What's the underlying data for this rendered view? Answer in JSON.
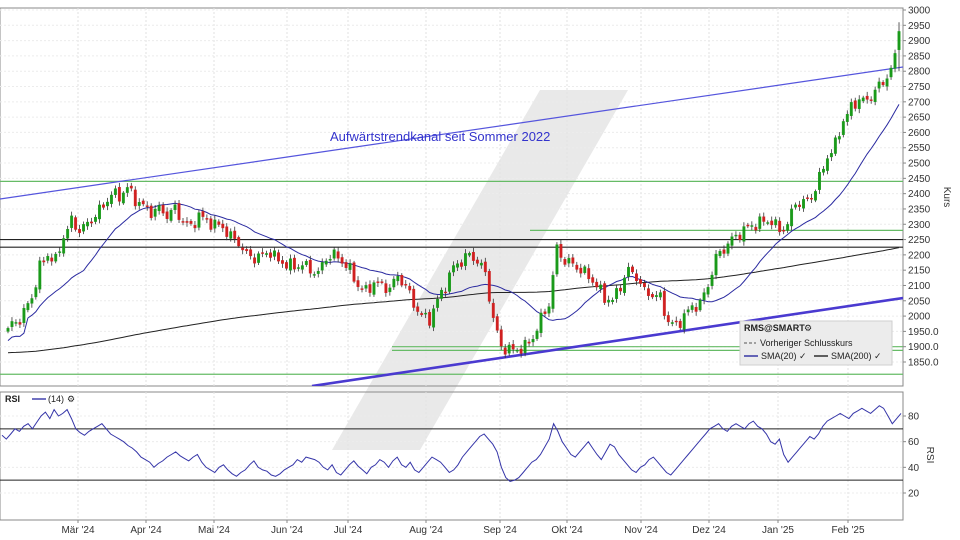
{
  "chart_data": [
    {
      "type": "candlestick",
      "name": "price",
      "ylabel": "Kurs",
      "ylim": [
        1800,
        3000
      ],
      "yticks": [
        1850,
        1900,
        1950,
        2000,
        2050,
        2100,
        2150,
        2200,
        2250,
        2300,
        2350,
        2400,
        2450,
        2500,
        2550,
        2600,
        2650,
        2700,
        2750,
        2800,
        2850,
        2900,
        2950,
        3000
      ],
      "ytick_labels": [
        "1850.0",
        "1900.0",
        "1950.0",
        "2000",
        "2050",
        "2100",
        "2150",
        "2200",
        "2250",
        "2300",
        "2350",
        "2400",
        "2450",
        "2500",
        "2550",
        "2600",
        "2650",
        "2700",
        "2750",
        "2800",
        "2850",
        "2900",
        "2950",
        "3000"
      ],
      "xticks": [
        "Mär '24",
        "Apr '24",
        "Mai '24",
        "Jun '24",
        "Jul '24",
        "Aug '24",
        "Sep '24",
        "Okt '24",
        "Nov '24",
        "Dez '24",
        "Jan '25",
        "Feb '25"
      ],
      "close_anchors": [
        [
          0,
          1960
        ],
        [
          3,
          1990
        ],
        [
          6,
          2060
        ],
        [
          8,
          2160
        ],
        [
          10,
          2200
        ],
        [
          12,
          2180
        ],
        [
          14,
          2260
        ],
        [
          16,
          2310
        ],
        [
          18,
          2280
        ],
        [
          20,
          2300
        ],
        [
          22,
          2330
        ],
        [
          24,
          2360
        ],
        [
          26,
          2400
        ],
        [
          28,
          2390
        ],
        [
          30,
          2420
        ],
        [
          32,
          2380
        ],
        [
          34,
          2360
        ],
        [
          36,
          2340
        ],
        [
          38,
          2350
        ],
        [
          40,
          2330
        ],
        [
          42,
          2350
        ],
        [
          44,
          2310
        ],
        [
          46,
          2290
        ],
        [
          48,
          2330
        ],
        [
          50,
          2310
        ],
        [
          52,
          2300
        ],
        [
          54,
          2290
        ],
        [
          56,
          2260
        ],
        [
          58,
          2240
        ],
        [
          60,
          2200
        ],
        [
          62,
          2190
        ],
        [
          64,
          2200
        ],
        [
          66,
          2210
        ],
        [
          68,
          2180
        ],
        [
          70,
          2170
        ],
        [
          72,
          2160
        ],
        [
          74,
          2170
        ],
        [
          76,
          2150
        ],
        [
          78,
          2140
        ],
        [
          80,
          2190
        ],
        [
          82,
          2200
        ],
        [
          84,
          2180
        ],
        [
          86,
          2150
        ],
        [
          88,
          2100
        ],
        [
          90,
          2080
        ],
        [
          92,
          2110
        ],
        [
          94,
          2100
        ],
        [
          96,
          2090
        ],
        [
          98,
          2130
        ],
        [
          100,
          2100
        ],
        [
          102,
          2040
        ],
        [
          104,
          2000
        ],
        [
          106,
          1990
        ],
        [
          108,
          2050
        ],
        [
          110,
          2100
        ],
        [
          112,
          2160
        ],
        [
          114,
          2180
        ],
        [
          116,
          2200
        ],
        [
          118,
          2180
        ],
        [
          120,
          2140
        ],
        [
          122,
          1990
        ],
        [
          124,
          1900
        ],
        [
          126,
          1890
        ],
        [
          128,
          1890
        ],
        [
          130,
          1900
        ],
        [
          132,
          1930
        ],
        [
          134,
          1990
        ],
        [
          136,
          2040
        ],
        [
          138,
          2220
        ],
        [
          140,
          2180
        ],
        [
          142,
          2170
        ],
        [
          144,
          2150
        ],
        [
          146,
          2130
        ],
        [
          148,
          2100
        ],
        [
          150,
          2060
        ],
        [
          152,
          2050
        ],
        [
          154,
          2100
        ],
        [
          156,
          2150
        ],
        [
          158,
          2130
        ],
        [
          160,
          2080
        ],
        [
          162,
          2070
        ],
        [
          164,
          2060
        ],
        [
          166,
          1980
        ],
        [
          168,
          1970
        ],
        [
          170,
          2000
        ],
        [
          172,
          2030
        ],
        [
          174,
          2040
        ],
        [
          176,
          2100
        ],
        [
          178,
          2190
        ],
        [
          180,
          2220
        ],
        [
          182,
          2250
        ],
        [
          184,
          2270
        ],
        [
          186,
          2290
        ],
        [
          188,
          2300
        ],
        [
          190,
          2310
        ],
        [
          192,
          2310
        ],
        [
          194,
          2280
        ],
        [
          196,
          2300
        ],
        [
          198,
          2370
        ],
        [
          200,
          2370
        ],
        [
          202,
          2390
        ],
        [
          204,
          2450
        ],
        [
          206,
          2520
        ],
        [
          208,
          2560
        ],
        [
          210,
          2640
        ],
        [
          212,
          2680
        ],
        [
          214,
          2710
        ],
        [
          216,
          2700
        ],
        [
          218,
          2740
        ],
        [
          220,
          2760
        ],
        [
          222,
          2810
        ],
        [
          224,
          2870
        ]
      ],
      "last_candle": {
        "open": 2870,
        "high": 2960,
        "low": 2800,
        "close": 2930
      },
      "annotation": "Aufwärtstrendkanal seit Sommer 2022",
      "legend": {
        "symbol": "RMS@SMART",
        "items": [
          "Vorheriger Schlusskurs",
          "SMA(20)",
          "SMA(200)"
        ]
      },
      "colors": {
        "up": "#1a9a1a",
        "down": "#d02020",
        "sma20": "#2a2aa0",
        "sma200": "#222222",
        "channel": "#5555dd",
        "support": "#66bb66"
      }
    },
    {
      "type": "line",
      "name": "RSI",
      "series": [
        {
          "name": "RSI",
          "period_label": "(14)"
        }
      ],
      "ylabel": "RSI",
      "ylim": [
        10,
        95
      ],
      "yticks": [
        20,
        40,
        60,
        80
      ],
      "guide_levels": [
        30,
        70
      ],
      "values": [
        65,
        62,
        66,
        70,
        68,
        72,
        74,
        70,
        75,
        80,
        83,
        78,
        85,
        80,
        82,
        85,
        78,
        70,
        67,
        65,
        68,
        70,
        72,
        74,
        70,
        66,
        64,
        62,
        60,
        57,
        55,
        52,
        48,
        46,
        44,
        40,
        43,
        45,
        48,
        50,
        52,
        49,
        47,
        45,
        48,
        50,
        44,
        40,
        38,
        36,
        40,
        42,
        38,
        35,
        33,
        36,
        38,
        42,
        45,
        40,
        38,
        37,
        34,
        33,
        35,
        38,
        40,
        42,
        46,
        44,
        48,
        47,
        46,
        44,
        40,
        38,
        42,
        36,
        34,
        38,
        42,
        45,
        41,
        38,
        35,
        40,
        42,
        46,
        44,
        40,
        45,
        48,
        42,
        40,
        44,
        38,
        36,
        40,
        44,
        48,
        46,
        44,
        40,
        36,
        38,
        42,
        48,
        52,
        56,
        60,
        64,
        66,
        62,
        58,
        52,
        40,
        32,
        29,
        30,
        32,
        36,
        40,
        44,
        46,
        50,
        56,
        62,
        74,
        68,
        60,
        55,
        50,
        48,
        52,
        56,
        60,
        55,
        50,
        46,
        52,
        58,
        56,
        50,
        46,
        42,
        38,
        36,
        40,
        42,
        46,
        48,
        44,
        40,
        36,
        34,
        38,
        42,
        46,
        50,
        54,
        58,
        62,
        66,
        70,
        72,
        74,
        70,
        68,
        72,
        74,
        72,
        70,
        74,
        76,
        72,
        70,
        66,
        60,
        58,
        62,
        50,
        44,
        48,
        52,
        56,
        60,
        64,
        62,
        66,
        72,
        76,
        78,
        80,
        82,
        80,
        78,
        82,
        84,
        86,
        84,
        82,
        85,
        88,
        86,
        80,
        74,
        78,
        82
      ]
    }
  ]
}
